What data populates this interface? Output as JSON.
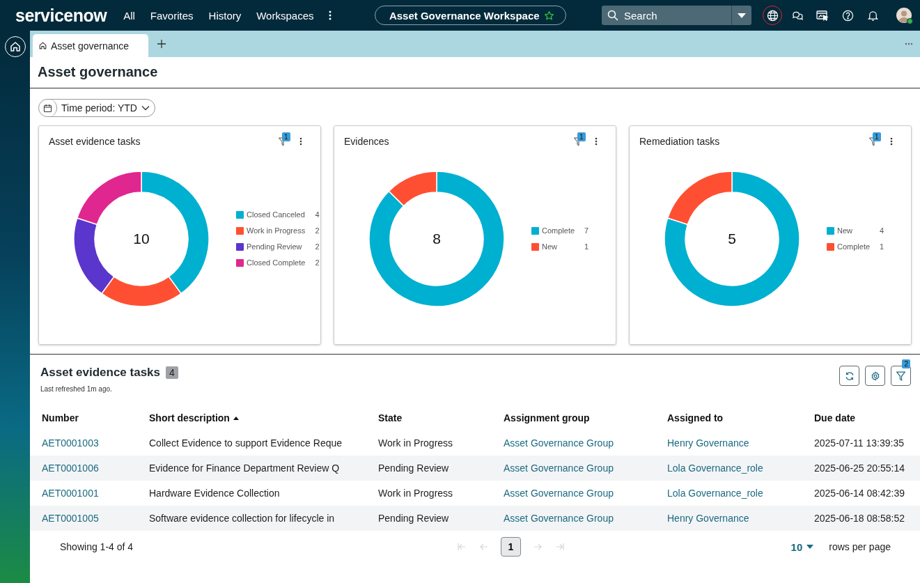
{
  "nav": {
    "logo": "servicenow",
    "menu": [
      {
        "label": "All"
      },
      {
        "label": "Favorites"
      },
      {
        "label": "History"
      },
      {
        "label": "Workspaces"
      }
    ],
    "workspace": "Asset Governance Workspace",
    "search": {
      "placeholder": "Search"
    },
    "icons": [
      {
        "kind": "globe",
        "focused": true
      },
      {
        "kind": "chat",
        "focused": false
      },
      {
        "kind": "screen",
        "focused": false
      },
      {
        "kind": "help",
        "focused": false
      },
      {
        "kind": "bell",
        "focused": false
      }
    ]
  },
  "tabs": [
    {
      "label": "Asset governance",
      "selected": true
    }
  ],
  "page_title": "Asset governance",
  "time_filter": "Time period: YTD",
  "cards": [
    {
      "filter_count": "1",
      "total": "10",
      "chart_data": {
        "type": "donut",
        "title": "Asset evidence tasks",
        "legend": true,
        "categories": [
          "Closed Canceled",
          "Work in Progress",
          "Pending Review",
          "Closed Complete"
        ],
        "values": [
          4,
          2,
          2,
          2
        ],
        "colors": [
          "#00b0d0",
          "#ff4f33",
          "#5a36cc",
          "#e0268f"
        ],
        "value_labels": [
          "4",
          "2",
          "2",
          "2"
        ]
      }
    },
    {
      "filter_count": "1",
      "total": "8",
      "chart_data": {
        "type": "donut",
        "title": "Evidences",
        "legend": true,
        "categories": [
          "Complete",
          "New"
        ],
        "values": [
          7,
          1
        ],
        "colors": [
          "#00b0d0",
          "#ff4f33"
        ],
        "value_labels": [
          "7",
          "1"
        ]
      }
    },
    {
      "filter_count": "1",
      "total": "5",
      "chart_data": {
        "type": "donut",
        "title": "Remediation tasks",
        "legend": true,
        "categories": [
          "New",
          "Complete"
        ],
        "values": [
          4,
          1
        ],
        "colors": [
          "#00b0d0",
          "#ff4f33"
        ],
        "value_labels": [
          "4",
          "1"
        ]
      }
    }
  ],
  "table": {
    "title": "Asset evidence tasks",
    "count": "4",
    "refreshed": "Last refreshed 1m ago.",
    "filter_count": "2",
    "columns": [
      {
        "label": "Number",
        "kind": "link",
        "sorted": false
      },
      {
        "label": "Short description",
        "kind": "text",
        "sorted": true
      },
      {
        "label": "State",
        "kind": "text",
        "sorted": false
      },
      {
        "label": "Assignment group",
        "kind": "link",
        "sorted": false
      },
      {
        "label": "Assigned to",
        "kind": "link",
        "sorted": false
      },
      {
        "label": "Due date",
        "kind": "text",
        "sorted": false
      }
    ],
    "rows": [
      [
        "AET0001003",
        "Collect Evidence to support Evidence Reque",
        "Work in Progress",
        "Asset Governance Group",
        "Henry Governance",
        "2025-07-11 13:39:35"
      ],
      [
        "AET0001006",
        "Evidence for Finance Department Review Q",
        "Pending Review",
        "Asset Governance Group",
        "Lola Governance_role",
        "2025-06-25 20:55:14"
      ],
      [
        "AET0001001",
        "Hardware Evidence Collection",
        "Work in Progress",
        "Asset Governance Group",
        "Lola Governance_role",
        "2025-06-14 08:42:39"
      ],
      [
        "AET0001005",
        "Software evidence collection for lifecycle in",
        "Pending Review",
        "Asset Governance Group",
        "Henry Governance",
        "2025-06-18 08:58:52"
      ]
    ]
  },
  "pagination": {
    "summary": "Showing 1-4 of 4",
    "arrows": [
      {
        "kind": "first",
        "disabled": true
      },
      {
        "kind": "prev",
        "disabled": true
      },
      {
        "kind": "next",
        "disabled": true
      },
      {
        "kind": "last",
        "disabled": true
      }
    ],
    "pages": [
      {
        "label": "1",
        "selected": true
      }
    ],
    "rows_per_page": "10",
    "rows_per_page_label": "rows per page"
  }
}
